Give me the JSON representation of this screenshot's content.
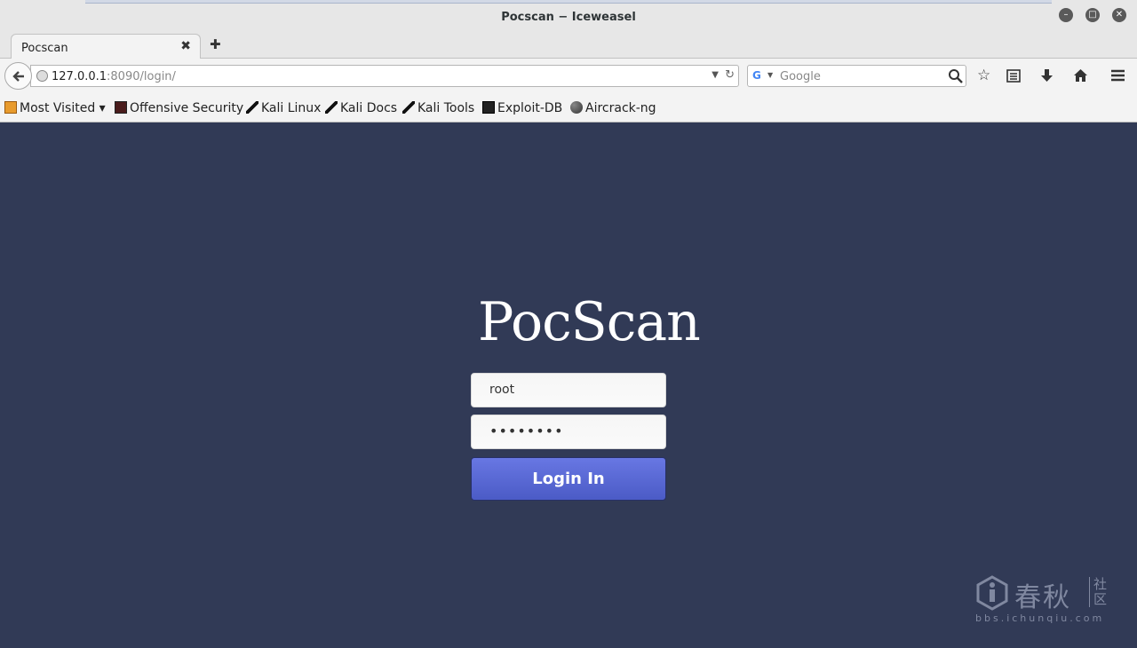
{
  "window": {
    "title": "Pocscan − Iceweasel"
  },
  "tab": {
    "title": "Pocscan",
    "close": "✖",
    "new_tab": "✚"
  },
  "nav": {
    "url_host": "127.0.0.1",
    "url_rest": ":8090/login/",
    "search_placeholder": "Google"
  },
  "bookmarks": [
    {
      "label": "Most Visited ▾",
      "icon": "folder-icon"
    },
    {
      "label": "Offensive Security",
      "icon": "offsec-icon"
    },
    {
      "label": "Kali Linux",
      "icon": "kali-icon"
    },
    {
      "label": "Kali Docs",
      "icon": "kali-icon"
    },
    {
      "label": "Kali Tools",
      "icon": "kali-icon"
    },
    {
      "label": "Exploit-DB",
      "icon": "exploitdb-icon"
    },
    {
      "label": "Aircrack-ng",
      "icon": "aircrack-icon"
    }
  ],
  "login": {
    "logo": "PocScan",
    "username_value": "root",
    "password_value": "••••••••",
    "button_label": "Login In"
  },
  "watermark": {
    "name": "春秋",
    "side": "社区",
    "url": "bbs.ichunqiu.com"
  },
  "colors": {
    "background": "#313a56",
    "button": "#5566d4"
  }
}
